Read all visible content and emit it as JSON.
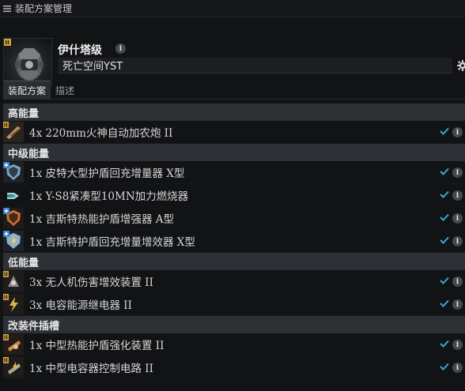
{
  "window": {
    "title": "装配方案管理"
  },
  "ship": {
    "name": "伊什塔级"
  },
  "fit_name": {
    "value": "死亡空间YST"
  },
  "tabs": [
    {
      "label": "装配方案",
      "active": true
    },
    {
      "label": "描述",
      "active": false
    }
  ],
  "sections": {
    "high": {
      "title": "高能量",
      "items": [
        {
          "text": "4x 220mm火神自动加农炮 II"
        }
      ]
    },
    "mid": {
      "title": "中级能量",
      "items": [
        {
          "text": "1x 皮特大型护盾回充增量器 X型"
        },
        {
          "text": "1x Y-S8紧凑型10MN加力燃烧器"
        },
        {
          "text": "1x 吉斯特热能护盾增强器 A型"
        },
        {
          "text": "1x 吉斯特护盾回充增量增效器 X型"
        }
      ]
    },
    "low": {
      "title": "低能量",
      "items": [
        {
          "text": "3x 无人机伤害增效装置 II"
        },
        {
          "text": "3x 电容能源继电器 II"
        }
      ]
    },
    "rig": {
      "title": "改装件插槽",
      "items": [
        {
          "text": "1x 中型热能护盾强化装置 II"
        },
        {
          "text": "1x 中型电容器控制电路 II"
        }
      ]
    }
  },
  "icons": {
    "menu": "menu-icon",
    "info": "info-icon",
    "settings": "gear-icon",
    "fitted": "checkmark-icon"
  },
  "colors": {
    "accent_check": "#3aa6d6",
    "tech2_badge": "#d4a23a",
    "faction_badge": "#3a7bd4"
  }
}
